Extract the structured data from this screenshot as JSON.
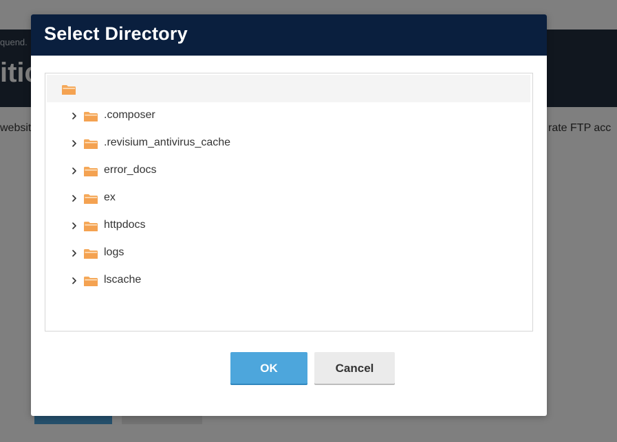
{
  "background": {
    "breadcrumb_fragment": "quend.",
    "title_fragment": "itic",
    "text_left_fragment": "website",
    "text_right_fragment": "rate FTP acc"
  },
  "dialog": {
    "title": "Select Directory",
    "root": {
      "icon": "folder-open-icon"
    },
    "items": [
      {
        "label": ".composer",
        "icon": "folder-icon",
        "expander": "chevron-right-icon"
      },
      {
        "label": ".revisium_antivirus_cache",
        "icon": "folder-icon",
        "expander": "chevron-right-icon"
      },
      {
        "label": "error_docs",
        "icon": "folder-icon",
        "expander": "chevron-right-icon"
      },
      {
        "label": "ex",
        "icon": "folder-icon",
        "expander": "chevron-right-icon"
      },
      {
        "label": "httpdocs",
        "icon": "folder-icon",
        "expander": "chevron-right-icon"
      },
      {
        "label": "logs",
        "icon": "folder-icon",
        "expander": "chevron-right-icon"
      },
      {
        "label": "lscache",
        "icon": "folder-icon",
        "expander": "chevron-right-icon"
      }
    ],
    "ok_label": "OK",
    "cancel_label": "Cancel"
  },
  "colors": {
    "dialog_header": "#0a1f3e",
    "primary_button": "#4da6dc",
    "folder": "#f5a95a",
    "selected_row": "#f4f4f4"
  }
}
